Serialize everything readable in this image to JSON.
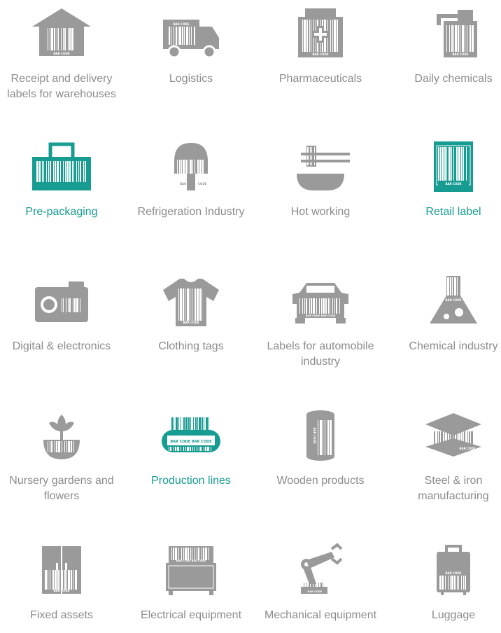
{
  "colors": {
    "icon_grey": "#9a9a9a",
    "accent": "#179c92",
    "text_grey": "#8c8c8c",
    "white": "#ffffff"
  },
  "tiles": [
    {
      "label": "Receipt and delivery labels for warehouses",
      "icon": "warehouse-icon",
      "active": false,
      "barcode_text": "BAR CODE"
    },
    {
      "label": "Logistics",
      "icon": "truck-icon",
      "active": false,
      "barcode_text": "BAR CODE"
    },
    {
      "label": "Pharmaceuticals",
      "icon": "medicine-box-icon",
      "active": false,
      "barcode_text": "BAR CODE"
    },
    {
      "label": "Daily chemicals",
      "icon": "spray-bottle-icon",
      "active": false,
      "barcode_text": "BAR CODE"
    },
    {
      "label": "Pre-packaging",
      "icon": "basket-icon",
      "active": true,
      "barcode_text": ""
    },
    {
      "label": "Refrigeration Industry",
      "icon": "ice-cream-icon",
      "active": false,
      "barcode_text": "BAR CODE"
    },
    {
      "label": "Hot working",
      "icon": "noodle-bowl-icon",
      "active": false,
      "barcode_text": ""
    },
    {
      "label": "Retail label",
      "icon": "snack-bag-icon",
      "active": true,
      "barcode_text": "BAR CODE"
    },
    {
      "label": "Digital & electronics",
      "icon": "camera-icon",
      "active": false,
      "barcode_text": "BAR CODE"
    },
    {
      "label": "Clothing tags",
      "icon": "tshirt-icon",
      "active": false,
      "barcode_text": "BAR CODE"
    },
    {
      "label": "Labels for automobile industry",
      "icon": "car-icon",
      "active": false,
      "barcode_text": "BAR CODE BAR CODE"
    },
    {
      "label": "Chemical industry",
      "icon": "flask-icon",
      "active": false,
      "barcode_text": "BAR CODE"
    },
    {
      "label": "Nursery gardens and flowers",
      "icon": "flower-pot-icon",
      "active": false,
      "barcode_text": ""
    },
    {
      "label": "Production lines",
      "icon": "conveyor-icon",
      "active": true,
      "barcode_text": "BAR CODE BAR CODE"
    },
    {
      "label": "Wooden products",
      "icon": "log-icon",
      "active": false,
      "barcode_text": "BAR CODE"
    },
    {
      "label": "Steel & iron manufacturing",
      "icon": "steel-sheet-icon",
      "active": false,
      "barcode_text": "BAR CODE"
    },
    {
      "label": "Fixed assets",
      "icon": "cabinet-icon",
      "active": false,
      "barcode_text": "BAR CODE"
    },
    {
      "label": "Electrical equipment",
      "icon": "electrical-box-icon",
      "active": false,
      "barcode_text": "BAR CODE BAR CODE"
    },
    {
      "label": "Mechanical equipment",
      "icon": "robot-arm-icon",
      "active": false,
      "barcode_text": "BAR CODE"
    },
    {
      "label": "Luggage",
      "icon": "suitcase-icon",
      "active": false,
      "barcode_text": "BAR CODE"
    }
  ]
}
